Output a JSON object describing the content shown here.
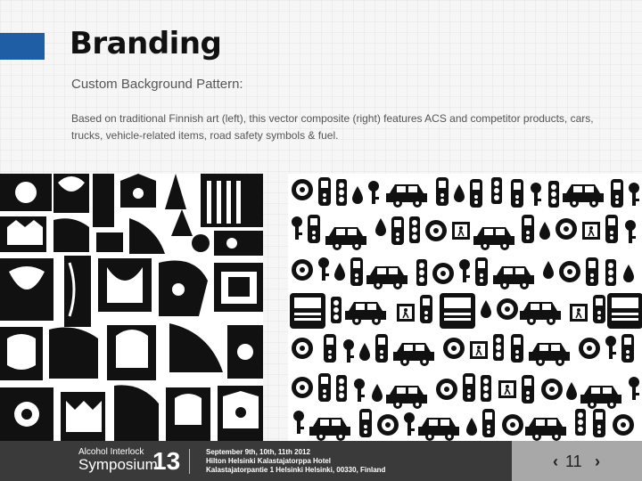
{
  "slide": {
    "title": "Branding",
    "subtitle": "Custom Background Pattern:",
    "description": "Based on traditional Finnish art (left), this vector composite (right) features ACS and competitor products, cars, trucks, vehicle-related items, road safety symbols & fuel.",
    "accent_color": "#1f5da5"
  },
  "images": {
    "left_alt": "Traditional Finnish art pattern",
    "right_alt": "Vector composite pattern of products, vehicles, road safety symbols and fuel"
  },
  "footer": {
    "brand_line1": "Alcohol Interlock",
    "brand_line2": "Symposium",
    "brand_year": "13",
    "date_line": "September 9th, 10th, 11th 2012",
    "venue_line": "Hilton Helsinki Kalastajatorppa Hotel",
    "address_line": "Kalastajatorpantie 1 Helsinki Helsinki, 00330, Finland"
  },
  "pager": {
    "prev_icon": "chevron-left-icon",
    "page_number": "11",
    "next_icon": "chevron-right-icon"
  }
}
